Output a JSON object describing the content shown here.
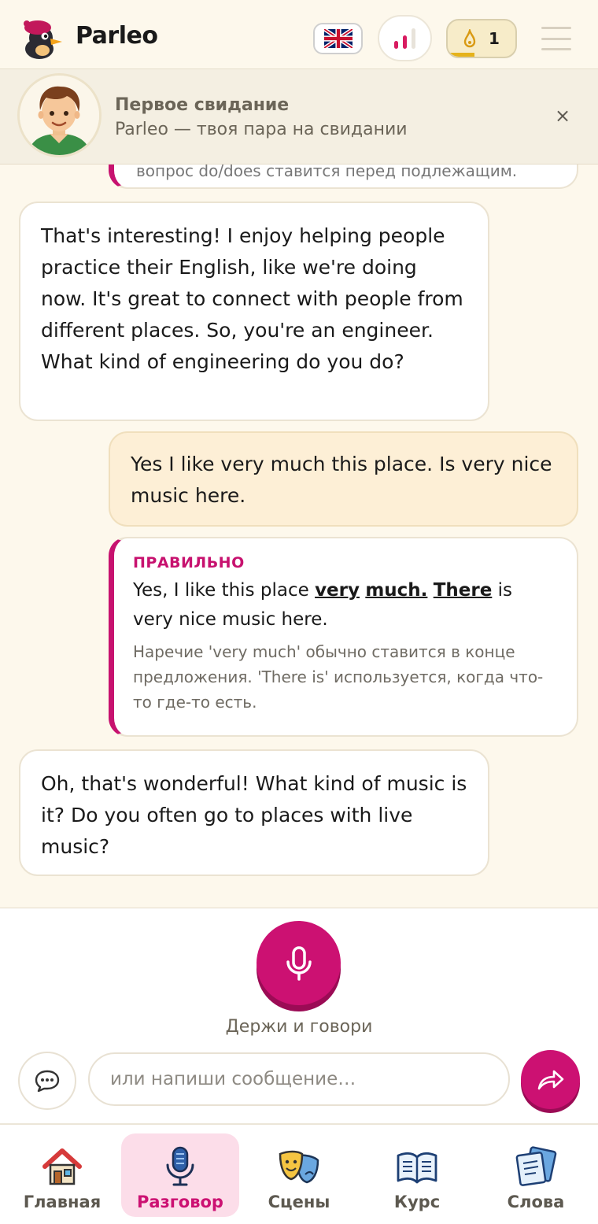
{
  "app": {
    "brand": "Parleo",
    "streak_count": "1",
    "streak_progress": 0.4,
    "language_flag": "uk-flag-icon",
    "accent_color": "#cc1172"
  },
  "scenario": {
    "title": "Первое свидание",
    "subtitle": "Parleo — твоя пара на свидании",
    "close": "×"
  },
  "chat": {
    "partial_text": "вопрос do/does ставится перед подлежащим.",
    "messages": [
      {
        "role": "bot",
        "text": "That's interesting! I enjoy helping people practice their English, like we're doing now. It's great to connect with people from different places. So, you're an engineer. What kind of engineering do you do?"
      },
      {
        "role": "user",
        "text": "Yes I like very much this place. Is very nice music here."
      },
      {
        "role": "correction",
        "label": "ПРАВИЛЬНО",
        "corrected_before": "Yes, I like this place ",
        "corrected_h1": "very",
        "corrected_h2": "much.",
        "corrected_h3": "There",
        "corrected_after": " is very nice music here.",
        "note": "Наречие 'very much' обычно ставится в конце предложения. 'There is' используется, когда что-то где-то есть."
      },
      {
        "role": "bot",
        "text": "Oh, that's wonderful! What kind of music is it? Do you often go to places with live music?"
      }
    ]
  },
  "input": {
    "hold_to_talk": "Держи и говори",
    "placeholder": "или напиши сообщение…"
  },
  "nav": {
    "items": [
      {
        "label": "Главная",
        "icon": "house-icon",
        "active": false
      },
      {
        "label": "Разговор",
        "icon": "microphone-icon",
        "active": true
      },
      {
        "label": "Сцены",
        "icon": "theater-masks-icon",
        "active": false
      },
      {
        "label": "Курс",
        "icon": "open-book-icon",
        "active": false
      },
      {
        "label": "Слова",
        "icon": "flashcards-icon",
        "active": false
      }
    ]
  }
}
